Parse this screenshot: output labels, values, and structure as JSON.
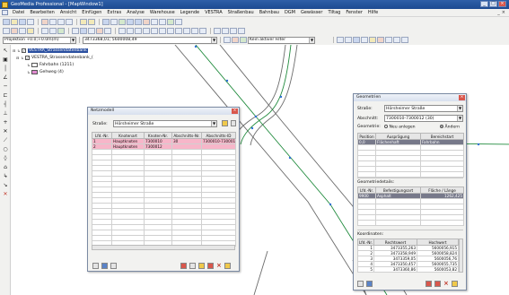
{
  "window": {
    "title": "GeoMedia Professional - [MapWindow1]",
    "buttons": [
      "_",
      "□",
      "×"
    ]
  },
  "menu": {
    "items": [
      "Datei",
      "Bearbeiten",
      "Ansicht",
      "Einfügen",
      "Extras",
      "Analyse",
      "Warehouse",
      "Legende",
      "VESTRA",
      "Straßenbau",
      "Bahnbau",
      "DGM",
      "Gewässer",
      "Tiltag",
      "Fenster",
      "Hilfe"
    ],
    "mdi_buttons": [
      "_",
      "×"
    ]
  },
  "toolbar3": {
    "projection_combo": "Projektion +0.0;+0.0m(m)",
    "coordinate_combo": "3473368,01; 5600008,49",
    "filter_combo": "Kein aktiver Filter"
  },
  "layer_tree": {
    "root": "VESTRA_Strassendatenbank",
    "child": "VESTRA_Strassendatenbank_(",
    "layers": [
      {
        "name": "Fahrbahn (1211)",
        "color": "#ffffff"
      },
      {
        "name": "Gehweg (4)",
        "color": "#e08ad0"
      }
    ]
  },
  "netzmodell": {
    "title": "Netzmodell",
    "strasse_label": "Straße:",
    "strasse_value": "Hörsheimer Straße",
    "columns": [
      "Lfd.-Nr.",
      "Knotenart",
      "Knoten-Nr.",
      "Abschnitts-Nr.",
      "Abschnitts-ID"
    ],
    "rows": [
      [
        "1",
        "Hauptknoten",
        "7300010",
        "30",
        "7300010-7300012"
      ],
      [
        "2",
        "Hauptknoten",
        "7300012",
        "",
        ""
      ]
    ]
  },
  "geometrien": {
    "title": "Geometrien",
    "strasse_label": "Straße:",
    "strasse_value": "Hörsheimer Straße",
    "abschnitt_label": "Abschnitt:",
    "abschnitt_value": "7300010-7300012 (30)",
    "geometrie_label": "Geometrie:",
    "neu_anlegen": "Neu anlegen",
    "aendern": "Ändern",
    "top_columns": [
      "Position",
      "Ausprägung",
      "Bereichstart"
    ],
    "top_rows": [
      [
        "0,0",
        "Flächenhaft",
        "Fahrbahn"
      ]
    ],
    "details_label": "Geometriedetails:",
    "details_columns": [
      "Lfd.-Nr.",
      "Befestigungsart",
      "Fläche / Länge"
    ],
    "details_rows": [
      [
        "9900",
        "Asphalt",
        "1262,425"
      ]
    ],
    "koord_label": "Koordinaten:",
    "koord_columns": [
      "Lfd.-Nr.",
      "Rechtswert",
      "Hochwert"
    ],
    "koord_rows": [
      [
        "1",
        "3473355,263",
        "5600056,915"
      ],
      [
        "2",
        "3473358,949",
        "5600058,824"
      ],
      [
        "3",
        "3473359,05",
        "5600056,76"
      ],
      [
        "4",
        "3473350,457",
        "5600055,735"
      ],
      [
        "5",
        "3473360,86",
        "5600053,82"
      ]
    ]
  },
  "colors": {
    "road_line": "#1f8a3c",
    "road_outline": "#666666",
    "point": "#2f6fd6"
  }
}
